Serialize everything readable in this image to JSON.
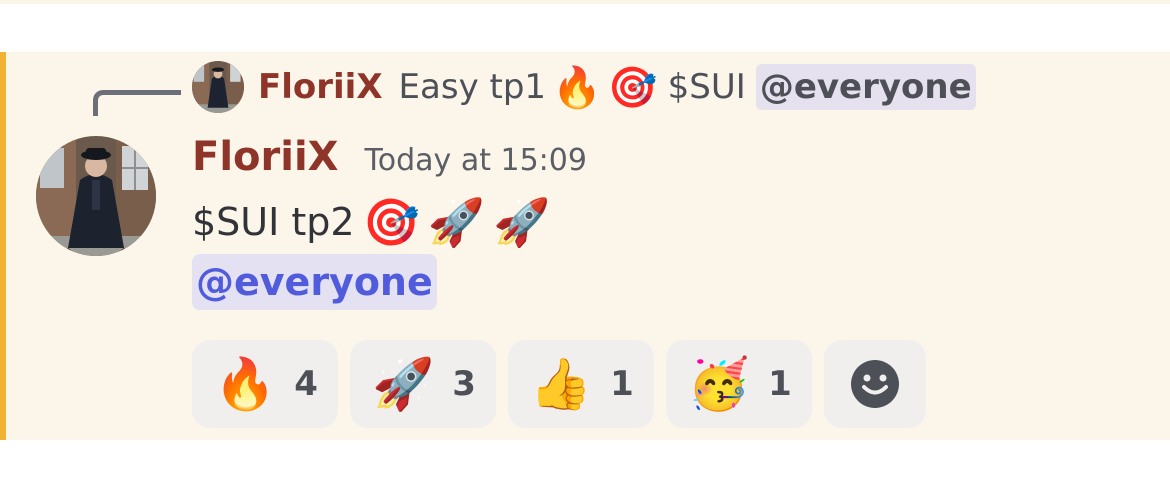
{
  "colors": {
    "mention_highlight_bar": "#f0b232",
    "message_background": "#fbf5ea",
    "author_color": "#8e3429",
    "mention_text": "#505cdc",
    "mention_background": "#e4e2f2",
    "reaction_background": "#f0efee"
  },
  "reply": {
    "author": "FloriiX",
    "text": "Easy tp1",
    "emojis": [
      "🔥",
      "🎯"
    ],
    "ticker": "$SUI",
    "mention": "@everyone",
    "avatar_icon": "avatar-photo-man-in-coat"
  },
  "message": {
    "author": "FloriiX",
    "timestamp": "Today at 15:09",
    "text": "$SUI tp2",
    "emojis": [
      "🎯",
      "🚀",
      "🚀"
    ],
    "mention": "@everyone",
    "avatar_icon": "avatar-photo-man-in-coat"
  },
  "reactions": [
    {
      "emoji": "🔥",
      "count": "4",
      "name": "fire"
    },
    {
      "emoji": "🚀",
      "count": "3",
      "name": "rocket"
    },
    {
      "emoji": "👍",
      "count": "1",
      "name": "thumbs-up"
    },
    {
      "emoji": "🥳",
      "count": "1",
      "name": "partying-face"
    }
  ],
  "add_reaction_icon": "smiley-face-icon"
}
